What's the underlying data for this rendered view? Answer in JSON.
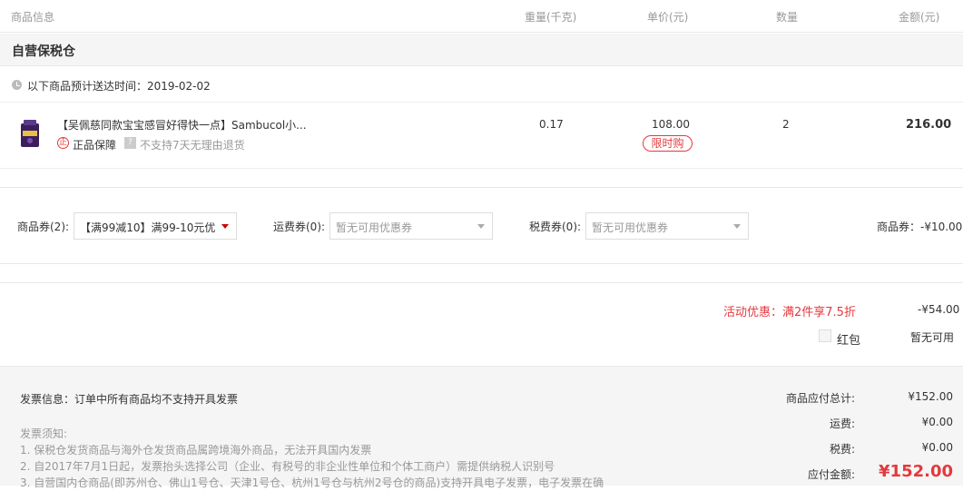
{
  "header": {
    "product_info": "商品信息",
    "weight": "重量(千克)",
    "unit_price": "单价(元)",
    "quantity": "数量",
    "amount": "金额(元)"
  },
  "warehouse": {
    "title": "自营保税仓"
  },
  "delivery": {
    "text": "以下商品预计送达时间：2019-02-02"
  },
  "item": {
    "title": "【吴佩慈同款宝宝感冒好得快一点】Sambucol小...",
    "guarantee": "正品保障",
    "guarantee_icon": "正",
    "no_return": "不支持7天无理由退货",
    "no_return_icon": "?",
    "weight": "0.17",
    "unit_price": "108.00",
    "tag": "限时购",
    "quantity": "2",
    "amount": "216.00"
  },
  "coupons": {
    "goods_label": "商品券(2):",
    "goods_value": "【满99减10】满99-10元优...",
    "shipping_label": "运费券(0):",
    "shipping_value": "暂无可用优惠券",
    "tax_label": "税费券(0):",
    "tax_value": "暂无可用优惠券",
    "discount_summary": "商品券：-¥10.00"
  },
  "promotion": {
    "text": "活动优惠：满2件享7.5折",
    "amount": "-¥54.00",
    "hongbao_label": "红包",
    "hongbao_value": "暂无可用"
  },
  "invoice": {
    "info": "发票信息：订单中所有商品均不支持开具发票",
    "notes_title": "发票须知:",
    "notes": [
      "1. 保税仓发货商品与海外仓发货商品属跨境海外商品，无法开具国内发票",
      "2. 自2017年7月1日起，发票抬头选择公司（企业、有税号的非企业性单位和个体工商户）需提供纳税人识别号",
      "3. 自营国内仓商品(即苏州仓、佛山1号仓、天津1号仓、杭州1号仓与杭州2号仓的商品)支持开具电子发票，电子发票在确"
    ]
  },
  "summary": {
    "goods_total_label": "商品应付总计:",
    "goods_total": "¥152.00",
    "shipping_label": "运费:",
    "shipping": "¥0.00",
    "tax_label": "税费:",
    "tax": "¥0.00",
    "payable_label": "应付金额:",
    "payable": "¥152.00"
  },
  "colors": {
    "accent": "#e4393c",
    "muted": "#999999",
    "band": "#f5f5f5"
  }
}
